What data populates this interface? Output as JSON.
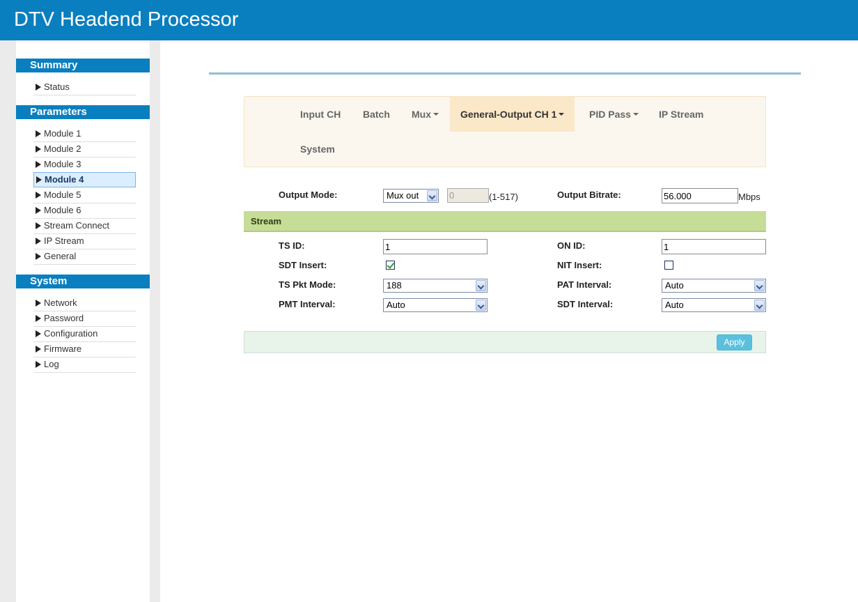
{
  "app": {
    "title": "DTV Headend Processor"
  },
  "sidebar": {
    "sections": [
      {
        "title": "Summary",
        "items": [
          "Status"
        ]
      },
      {
        "title": "Parameters",
        "items": [
          "Module 1",
          "Module 2",
          "Module 3",
          "Module 4",
          "Module 5",
          "Module 6",
          "Stream Connect",
          "IP Stream",
          "General"
        ]
      },
      {
        "title": "System",
        "items": [
          "Network",
          "Password",
          "Configuration",
          "Firmware",
          "Log"
        ]
      }
    ],
    "active_item": "Module 4"
  },
  "tabs": {
    "input_ch": "Input CH",
    "batch": "Batch",
    "mux": "Mux",
    "general_output": "General-Output CH 1",
    "pid_pass": "PID Pass",
    "ip_stream": "IP Stream",
    "system": "System",
    "active": "General-Output CH 1"
  },
  "output": {
    "mode_label": "Output Mode:",
    "mode_value": "Mux out",
    "mode_number": "0",
    "mode_range": "(1-517)",
    "bitrate_label": "Output Bitrate:",
    "bitrate_value": "56.000",
    "bitrate_unit": "Mbps"
  },
  "stream": {
    "section_title": "Stream",
    "ts_id_label": "TS ID:",
    "ts_id_value": "1",
    "on_id_label": "ON ID:",
    "on_id_value": "1",
    "sdt_insert_label": "SDT Insert:",
    "sdt_insert_checked": true,
    "nit_insert_label": "NIT Insert:",
    "nit_insert_checked": false,
    "ts_pkt_mode_label": "TS Pkt Mode:",
    "ts_pkt_mode_value": "188",
    "pat_interval_label": "PAT Interval:",
    "pat_interval_value": "Auto",
    "pmt_interval_label": "PMT Interval:",
    "pmt_interval_value": "Auto",
    "sdt_interval_label": "SDT Interval:",
    "sdt_interval_value": "Auto"
  },
  "actions": {
    "apply_label": "Apply"
  },
  "colors": {
    "header": "#0a7fbf",
    "tab_bar": "#fbf7ef",
    "tab_active": "#fbe8c8",
    "stream_bar": "#c6dd97",
    "apply": "#5bc0de"
  }
}
